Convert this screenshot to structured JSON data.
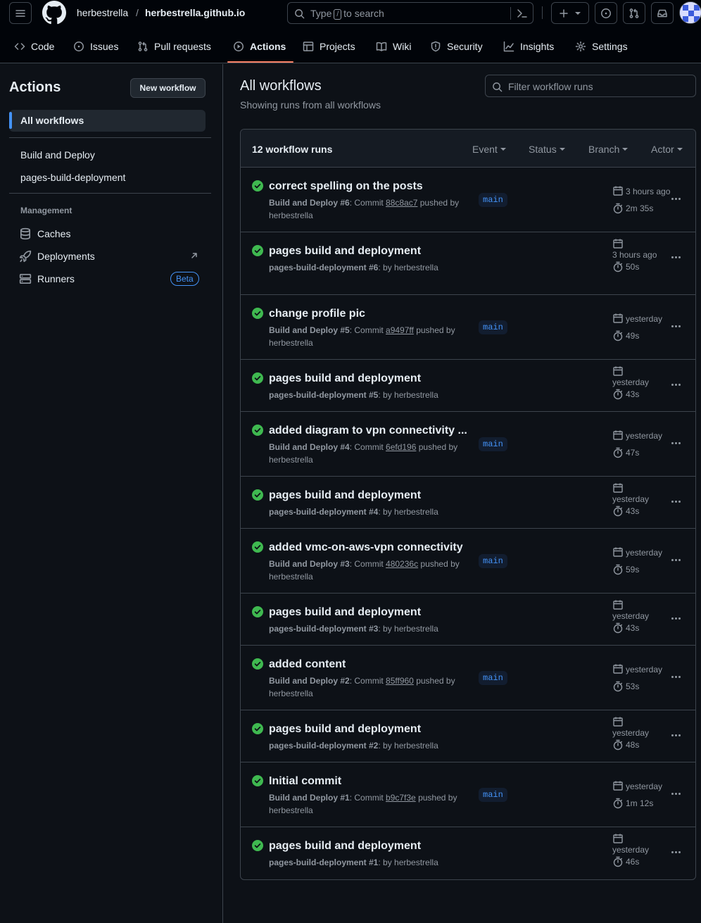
{
  "header": {
    "owner": "herbestrella",
    "separator": "/",
    "repo": "herbestrella.github.io",
    "search_prefix": "Type",
    "search_key": "/",
    "search_suffix": "to search"
  },
  "tabs": [
    {
      "label": "Code",
      "icon": "code-icon"
    },
    {
      "label": "Issues",
      "icon": "issue-icon"
    },
    {
      "label": "Pull requests",
      "icon": "pull-request-icon"
    },
    {
      "label": "Actions",
      "icon": "play-icon",
      "active": true
    },
    {
      "label": "Projects",
      "icon": "table-icon"
    },
    {
      "label": "Wiki",
      "icon": "book-icon"
    },
    {
      "label": "Security",
      "icon": "shield-icon"
    },
    {
      "label": "Insights",
      "icon": "graph-icon"
    },
    {
      "label": "Settings",
      "icon": "gear-icon"
    }
  ],
  "sidebar": {
    "title": "Actions",
    "new_workflow": "New workflow",
    "all_workflows": "All workflows",
    "workflows": [
      "Build and Deploy",
      "pages-build-deployment"
    ],
    "management_heading": "Management",
    "management": [
      {
        "label": "Caches",
        "icon": "database-icon"
      },
      {
        "label": "Deployments",
        "icon": "rocket-icon"
      },
      {
        "label": "Runners",
        "icon": "server-icon"
      }
    ],
    "runners_badge": "Beta"
  },
  "main": {
    "title": "All workflows",
    "subtitle": "Showing runs from all workflows",
    "filter_placeholder": "Filter workflow runs",
    "runs_count": "12 workflow runs",
    "filters": [
      "Event",
      "Status",
      "Branch",
      "Actor"
    ]
  },
  "runs": [
    {
      "title": "correct spelling on the posts",
      "workflow": "Build and Deploy #6",
      "commit_prefix": ": Commit ",
      "sha": "88c8ac7",
      "suffix": " pushed by herbestrella",
      "branch": "main",
      "when": "3 hours ago",
      "duration": "2m 35s"
    },
    {
      "title": "pages build and deployment",
      "workflow": "pages-build-deployment #6",
      "commit_prefix": ": by herbestrella",
      "sha": "",
      "suffix": "",
      "branch": "",
      "when": "3 hours ago",
      "duration": "50s"
    },
    {
      "title": "change profile pic",
      "workflow": "Build and Deploy #5",
      "commit_prefix": ": Commit ",
      "sha": "a9497ff",
      "suffix": " pushed by herbestrella",
      "branch": "main",
      "when": "yesterday",
      "duration": "49s"
    },
    {
      "title": "pages build and deployment",
      "workflow": "pages-build-deployment #5",
      "commit_prefix": ": by herbestrella",
      "sha": "",
      "suffix": "",
      "branch": "",
      "when": "yesterday",
      "duration": "43s"
    },
    {
      "title": "added diagram to vpn connectivity ...",
      "workflow": "Build and Deploy #4",
      "commit_prefix": ": Commit ",
      "sha": "6efd196",
      "suffix": " pushed by herbestrella",
      "branch": "main",
      "when": "yesterday",
      "duration": "47s"
    },
    {
      "title": "pages build and deployment",
      "workflow": "pages-build-deployment #4",
      "commit_prefix": ": by herbestrella",
      "sha": "",
      "suffix": "",
      "branch": "",
      "when": "yesterday",
      "duration": "43s"
    },
    {
      "title": "added vmc-on-aws-vpn connectivity",
      "workflow": "Build and Deploy #3",
      "commit_prefix": ": Commit ",
      "sha": "480236c",
      "suffix": " pushed by herbestrella",
      "branch": "main",
      "when": "yesterday",
      "duration": "59s"
    },
    {
      "title": "pages build and deployment",
      "workflow": "pages-build-deployment #3",
      "commit_prefix": ": by herbestrella",
      "sha": "",
      "suffix": "",
      "branch": "",
      "when": "yesterday",
      "duration": "43s"
    },
    {
      "title": "added content",
      "workflow": "Build and Deploy #2",
      "commit_prefix": ": Commit ",
      "sha": "85ff960",
      "suffix": " pushed by herbestrella",
      "branch": "main",
      "when": "yesterday",
      "duration": "53s"
    },
    {
      "title": "pages build and deployment",
      "workflow": "pages-build-deployment #2",
      "commit_prefix": ": by herbestrella",
      "sha": "",
      "suffix": "",
      "branch": "",
      "when": "yesterday",
      "duration": "48s"
    },
    {
      "title": "Initial commit",
      "workflow": "Build and Deploy #1",
      "commit_prefix": ": Commit ",
      "sha": "b9c7f3e",
      "suffix": " pushed by herbestrella",
      "branch": "main",
      "when": "yesterday",
      "duration": "1m 12s"
    },
    {
      "title": "pages build and deployment",
      "workflow": "pages-build-deployment #1",
      "commit_prefix": ": by herbestrella",
      "sha": "",
      "suffix": "",
      "branch": "",
      "when": "yesterday",
      "duration": "46s"
    }
  ],
  "colors": {
    "success": "#3fb950",
    "accent": "#4493f8",
    "tab_underline": "#f78166"
  }
}
